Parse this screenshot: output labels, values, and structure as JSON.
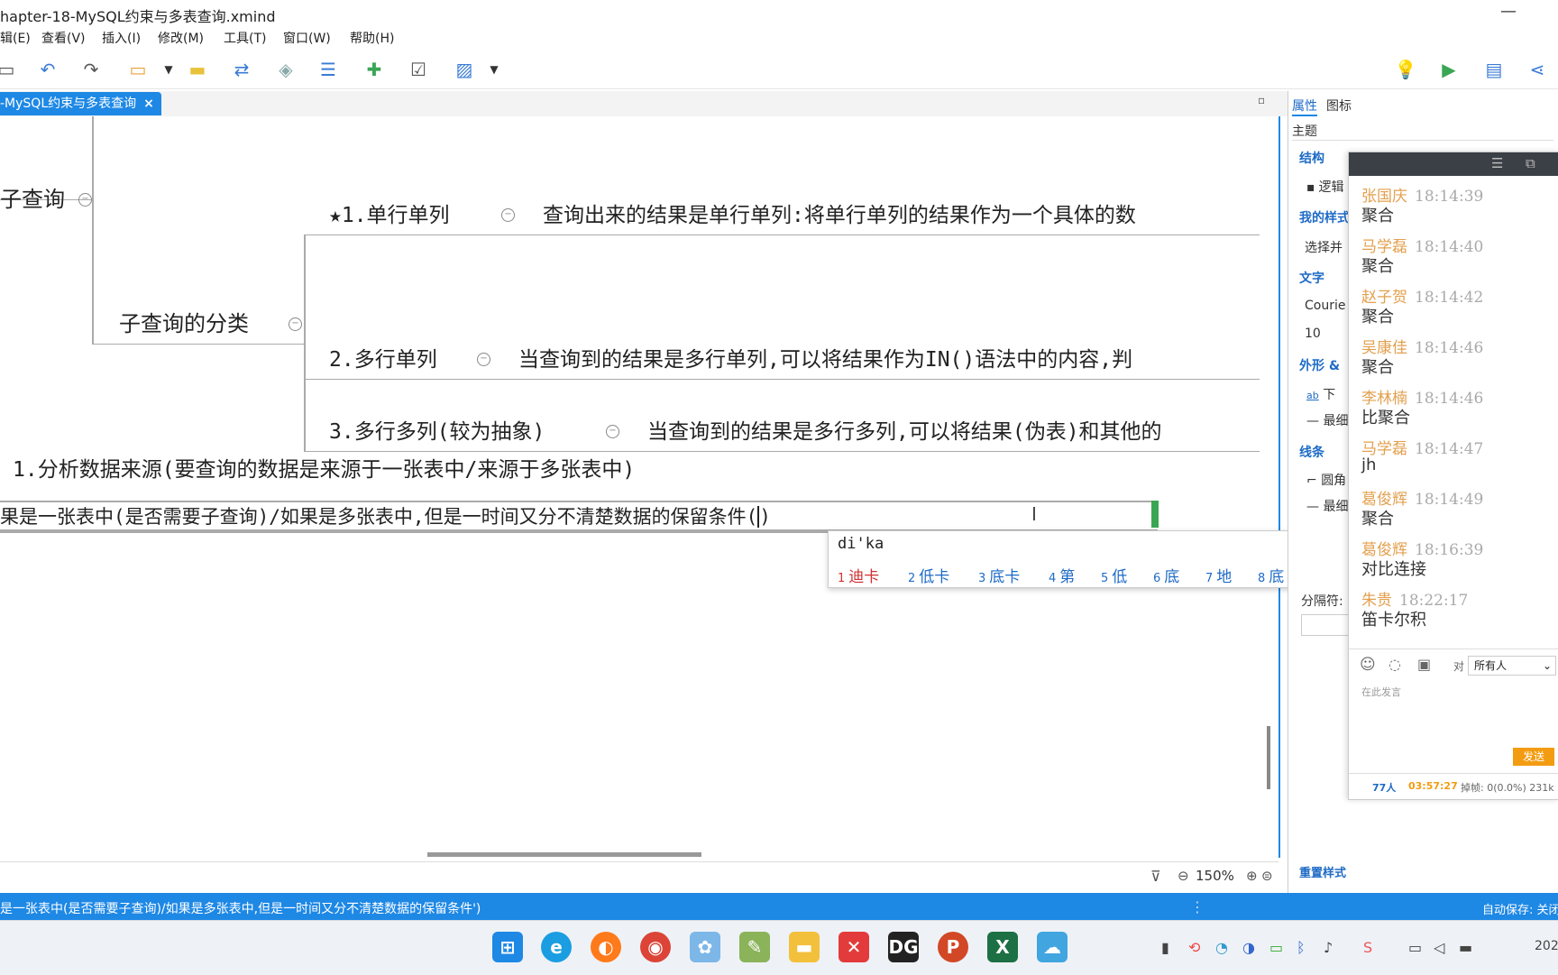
{
  "window": {
    "title": "hapter-18-MySQL约束与多表查询.xmind",
    "min_symbol": "—"
  },
  "menu": [
    "辑(E)",
    "查看(V)",
    "插入(I)",
    "修改(M)",
    "工具(T)",
    "窗口(W)",
    "帮助(H)"
  ],
  "toolbar": {
    "icons": [
      "save-icon",
      "undo-icon",
      "redo-icon",
      "topic-icon",
      "dropdown-icon",
      "callout-icon",
      "relationship-icon",
      "summary-icon",
      "boundary-icon",
      "subtopic-icon",
      "label-icon",
      "image-icon",
      "image-dropdown-icon"
    ],
    "right_icons": [
      "idea-icon",
      "presentation-icon",
      "layout-icon",
      "share-icon"
    ]
  },
  "tab": {
    "label": "-MySQL约束与多表查询",
    "close": "×"
  },
  "mindmap": {
    "topic_subquery": "子查询",
    "topic_category": "子查询的分类",
    "single_row": "★1.单行单列",
    "single_row_desc": "查询出来的结果是单行单列:将单行单列的结果作为一个具体的数",
    "multi_row": "2.多行单列",
    "multi_row_desc": "当查询到的结果是多行单列,可以将结果作为IN()语法中的内容,判",
    "multi_col": "3.多行多列(较为抽象)",
    "multi_col_desc": "当查询到的结果是多行多列,可以将结果(伪表)和其他的",
    "analyze": "1.分析数据来源(要查询的数据是来源于一张表中/来源于多张表中)",
    "editing": "果是一张表中(是否需要子查询)/如果是多张表中,但是一时间又分不清楚数据的保留条件(",
    "editing_paren": ")",
    "collapse_symbol": "−"
  },
  "ime": {
    "input": "di'ka",
    "candidates": [
      {
        "n": "1",
        "text": "迪卡"
      },
      {
        "n": "2",
        "text": "低卡"
      },
      {
        "n": "3",
        "text": "底卡"
      },
      {
        "n": "4",
        "text": "第"
      },
      {
        "n": "5",
        "text": "低"
      },
      {
        "n": "6",
        "text": "底"
      },
      {
        "n": "7",
        "text": "地"
      },
      {
        "n": "8",
        "text": "底"
      }
    ],
    "nav": "‹ ›"
  },
  "zoom": {
    "value": "150%"
  },
  "panel": {
    "tab_props": "属性",
    "tab_icons": "图标",
    "subject": "主题",
    "sec_structure": "结构",
    "structure_value": "逻辑",
    "sec_mystyle": "我的样式",
    "style_value": "选择并",
    "sec_text": "文字",
    "font_value": "Courie",
    "size_value": "10",
    "sec_shape": "外形 &",
    "shape_value": "下",
    "shape_value2": "最细",
    "sec_line": "线条",
    "line_value": "圆角",
    "line_value2": "最细",
    "separator": "分隔符:",
    "reset": "重置样式"
  },
  "chat": {
    "messages": [
      {
        "name": "张国庆",
        "time": "18:14:39",
        "text": "聚合"
      },
      {
        "name": "马学磊",
        "time": "18:14:40",
        "text": "聚合"
      },
      {
        "name": "赵子贺",
        "time": "18:14:42",
        "text": "聚合"
      },
      {
        "name": "吴康佳",
        "time": "18:14:46",
        "text": "聚合"
      },
      {
        "name": "李林楠",
        "time": "18:14:46",
        "text": "比聚合"
      },
      {
        "name": "马学磊",
        "time": "18:14:47",
        "text": "jh"
      },
      {
        "name": "葛俊辉",
        "time": "18:14:49",
        "text": "聚合"
      },
      {
        "name": "葛俊辉",
        "time": "18:16:39",
        "text": "对比连接"
      },
      {
        "name": "朱贵",
        "time": "18:22:17",
        "text": "笛卡尔积"
      }
    ],
    "to_label": "对",
    "target": "所有人",
    "placeholder": "在此发言",
    "send": "发送",
    "count": "77人",
    "duration": "03:57:27",
    "stats": "掉帧: 0(0.0%) 231k"
  },
  "status": {
    "text": "是一张表中(是否需要子查询)/如果是多张表中,但是一时间又分不清楚数据的保留条件')",
    "autosave": "自动保存: 关闭"
  },
  "taskbar": {
    "apps": [
      "windows-start-icon",
      "edge-icon",
      "firefox-icon",
      "chrome-icon",
      "app-icon",
      "app2-icon",
      "file-explorer-icon",
      "xmind-icon",
      "datagrip-icon",
      "powerpoint-icon",
      "excel-icon",
      "cloud-icon"
    ],
    "clock": "202"
  }
}
